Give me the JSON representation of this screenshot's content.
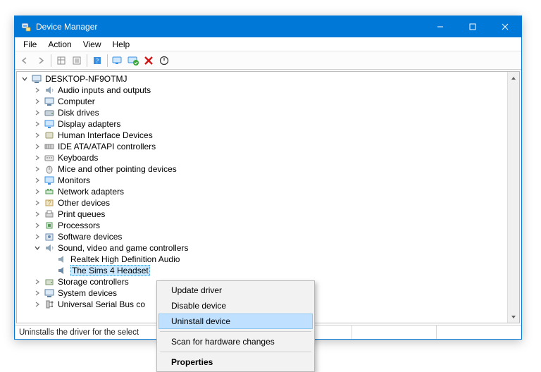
{
  "window": {
    "title": "Device Manager"
  },
  "menu": {
    "file": "File",
    "action": "Action",
    "view": "View",
    "help": "Help"
  },
  "tree": {
    "root": "DESKTOP-NF9OTMJ",
    "items": [
      "Audio inputs and outputs",
      "Computer",
      "Disk drives",
      "Display adapters",
      "Human Interface Devices",
      "IDE ATA/ATAPI controllers",
      "Keyboards",
      "Mice and other pointing devices",
      "Monitors",
      "Network adapters",
      "Other devices",
      "Print queues",
      "Processors",
      "Software devices"
    ],
    "sound_category": "Sound, video and game controllers",
    "sound_children": [
      "Realtek High Definition Audio",
      "The Sims 4 Headset"
    ],
    "after": [
      "Storage controllers",
      "System devices",
      "Universal Serial Bus co"
    ]
  },
  "context_menu": {
    "update": "Update driver",
    "disable": "Disable device",
    "uninstall": "Uninstall device",
    "scan": "Scan for hardware changes",
    "properties": "Properties"
  },
  "status": {
    "text": "Uninstalls the driver for the select"
  }
}
